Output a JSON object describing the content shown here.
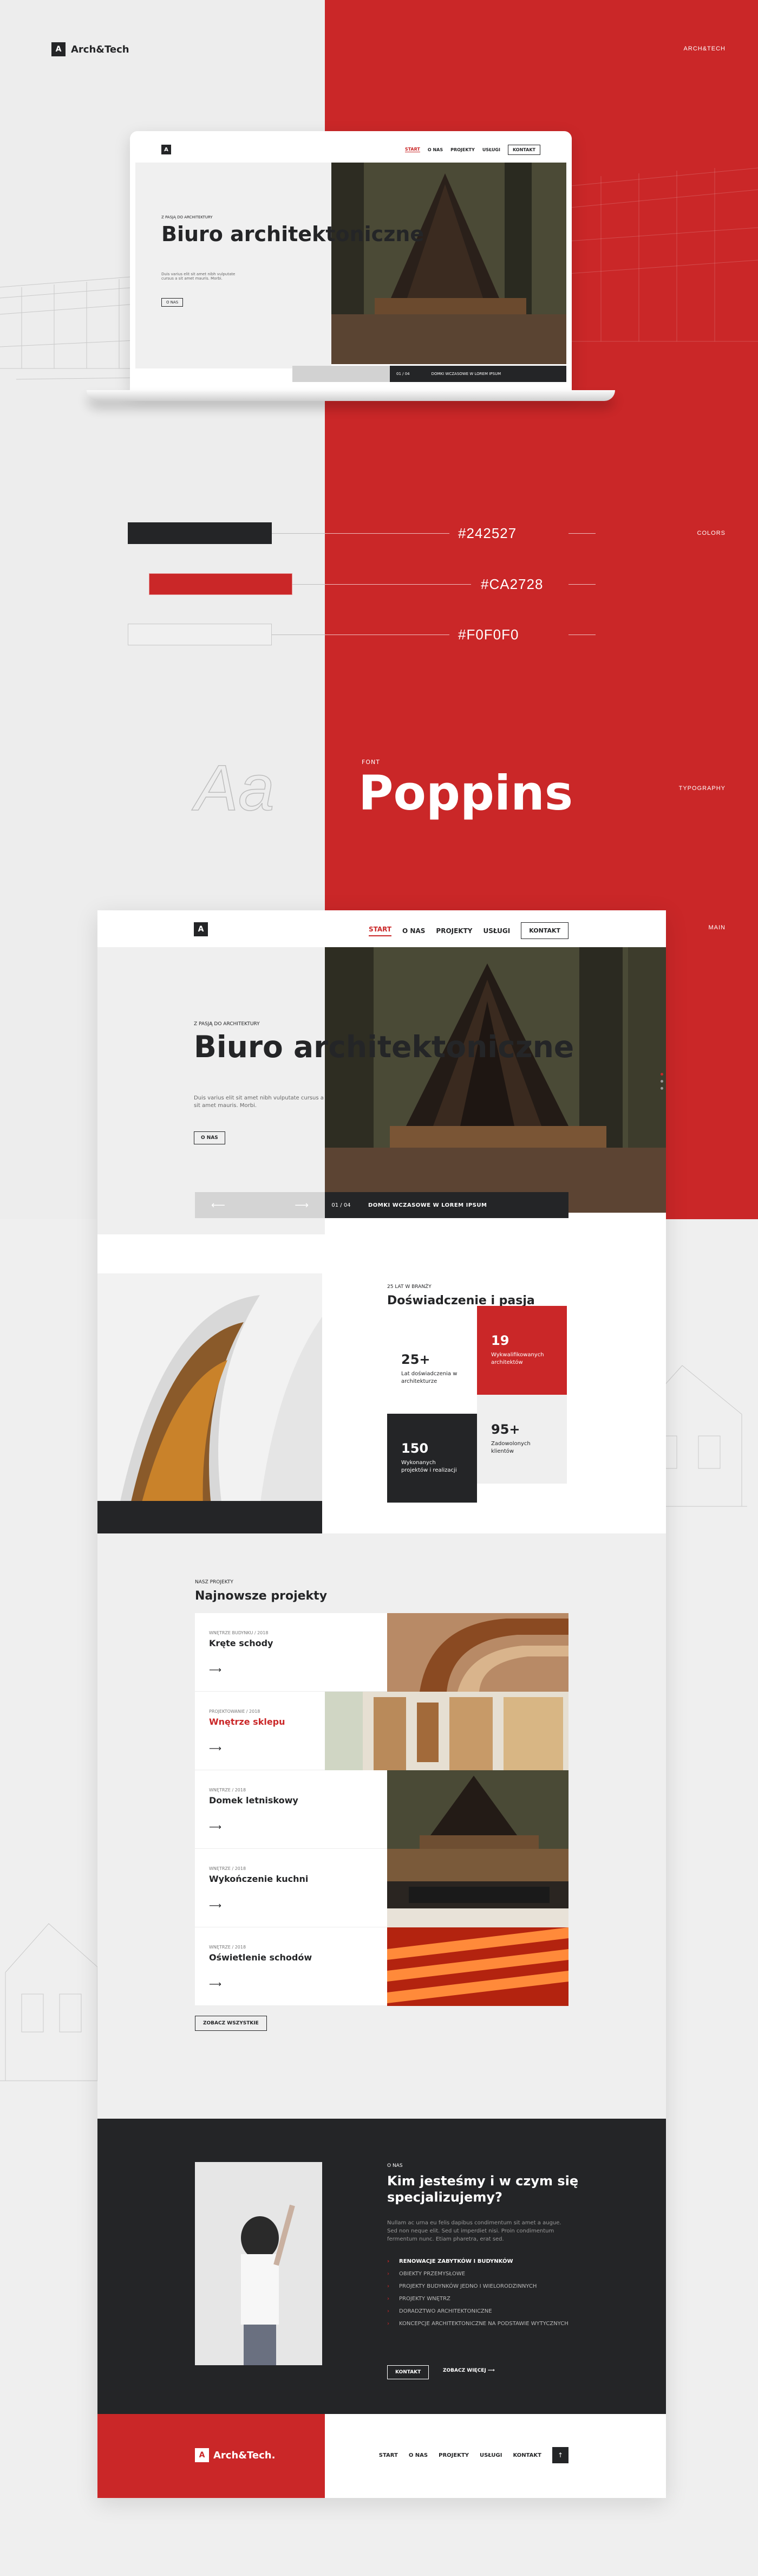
{
  "brand": {
    "logo_mark": "A",
    "name": "Arch&Tech",
    "footer_name": "Arch&Tech."
  },
  "side_tags": {
    "archtech": "ARCH&TECH",
    "colors": "COLORS",
    "typography": "TYPOGRAPHY",
    "main": "MAIN"
  },
  "colors": [
    {
      "hex": "#242527",
      "label": "#242527"
    },
    {
      "hex": "#CA2728",
      "label": "#CA2728"
    },
    {
      "hex": "#F0F0F0",
      "label": "#F0F0F0"
    }
  ],
  "typography": {
    "sample": "Aa",
    "font_label": "FONT",
    "font_name": "Poppins"
  },
  "nav": {
    "items": [
      "START",
      "O NAS",
      "PROJEKTY",
      "USŁUGI"
    ],
    "contact": "KONTAKT"
  },
  "hero": {
    "eyebrow": "Z PASJĄ DO ARCHITEKTURY",
    "title": "Biuro architektoniczne",
    "subtitle": "Duis varius elit sit amet nibh vulputate cursus a sit amet mauris. Morbi.",
    "more": "O NAS",
    "counter": "01 / 04",
    "caption": "DOMKI WCZASOWE W LOREM IPSUM",
    "prev": "⟵",
    "next": "⟶"
  },
  "about": {
    "eyebrow": "25 LAT W BRANŻY",
    "title": "Doświadczenie i pasja",
    "stats": [
      {
        "num": "25+",
        "label": "Lat doświadczenia w architekturze"
      },
      {
        "num": "19",
        "label": "Wykwalifikowanych architektów"
      },
      {
        "num": "150",
        "label": "Wykonanych projektów i realizacji"
      },
      {
        "num": "95+",
        "label": "Zadowolonych klientów"
      }
    ]
  },
  "projects": {
    "eyebrow": "NASZ PROJEKTY",
    "title": "Najnowsze projekty",
    "items": [
      {
        "category": "WNĘTRZE BUDYNKU / 2018",
        "name": "Kręte schody"
      },
      {
        "category": "PROJEKTOWANIE / 2018",
        "name": "Wnętrze sklepu"
      },
      {
        "category": "WNĘTRZE / 2018",
        "name": "Domek letniskowy"
      },
      {
        "category": "WNĘTRZE / 2018",
        "name": "Wykończenie kuchni"
      },
      {
        "category": "WNĘTRZE / 2018",
        "name": "Oświetlenie schodów"
      }
    ],
    "arrow": "⟶",
    "all": "ZOBACZ WSZYSTKIE"
  },
  "who": {
    "eyebrow": "O NAS",
    "title": "Kim jesteśmy i w czym się specjalizujemy?",
    "text": "Nullam ac urna eu felis dapibus condimentum sit amet a augue. Sed non neque elit. Sed ut imperdiet nisi. Proin condimentum fermentum nunc. Etiam pharetra, erat sed.",
    "services": [
      "RENOWACJE ZABYTKÓW I BUDYNKÓW",
      "OBIEKTY PRZEMYSŁOWE",
      "PROJEKTY BUDYNKÓW JEDNO I WIELORODZINNYCH",
      "PROJEKTY WNĘTRZ",
      "DORADZTWO ARCHITEKTONICZNE",
      "KONCEPCJE ARCHITEKTONICZNE NA PODSTAWIE WYTYCZNYCH"
    ],
    "contact": "KONTAKT",
    "more": "ZOBACZ WIĘCEJ ⟶"
  },
  "footer": {
    "links": [
      "START",
      "O NAS",
      "PROJEKTY",
      "USŁUGI",
      "KONTAKT"
    ],
    "up": "↑"
  }
}
